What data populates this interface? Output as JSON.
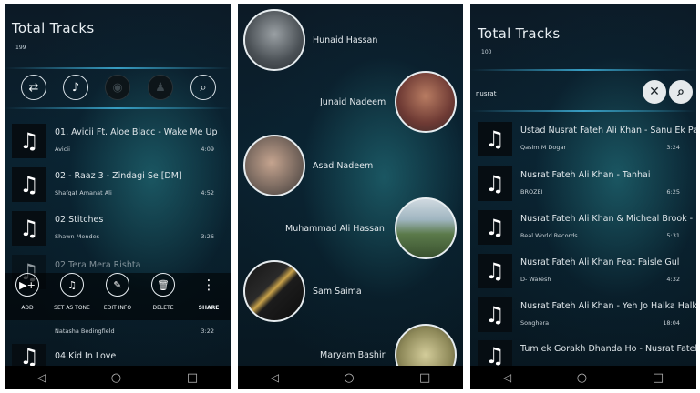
{
  "screen1": {
    "title": "Total Tracks",
    "count": "199",
    "controls": [
      {
        "icon": "shuffle-icon",
        "glyph": "⇄"
      },
      {
        "icon": "music-note-icon",
        "glyph": "♪"
      },
      {
        "icon": "disc-icon",
        "glyph": "◉"
      },
      {
        "icon": "artist-icon",
        "glyph": "♟"
      },
      {
        "icon": "search-icon",
        "glyph": "⌕"
      }
    ],
    "tracks": [
      {
        "name": "01. Avicii Ft. Aloe Blacc - Wake Me Up",
        "artist": "Avicii",
        "duration": "4:09"
      },
      {
        "name": "02 - Raaz 3 - Zindagi Se [DM]",
        "artist": "Shafqat Amanat Ali",
        "duration": "4:52"
      },
      {
        "name": "02 Stitches",
        "artist": "Shawn Mendes",
        "duration": "3:26"
      },
      {
        "name": "02 Tera Mera Rishta",
        "artist": "",
        "duration": ""
      },
      {
        "name": "",
        "artist": "Natasha Bedingfield",
        "duration": "3:22"
      },
      {
        "name": "04 Kid In Love",
        "artist": "",
        "duration": ""
      }
    ],
    "actions": [
      {
        "label": "ADD",
        "icon": "play-add-icon",
        "glyph": "▶+"
      },
      {
        "label": "SET AS TONE",
        "icon": "phone-tone-icon",
        "glyph": "♫"
      },
      {
        "label": "EDIT INFO",
        "icon": "edit-icon",
        "glyph": "✎"
      },
      {
        "label": "DELETE",
        "icon": "trash-icon",
        "glyph": "🗑"
      },
      {
        "label": "SHARE",
        "icon": "more-vert-icon",
        "glyph": "⋮"
      }
    ]
  },
  "screen2": {
    "contacts": [
      {
        "name": "Hunaid Hassan",
        "avatar_color": "#6b6f73"
      },
      {
        "name": "Junaid Nadeem",
        "avatar_color": "#8a3f3f"
      },
      {
        "name": "Asad Nadeem",
        "avatar_color": "#7b6a60"
      },
      {
        "name": "Muhammad Ali Hassan",
        "avatar_color": "#5b7a4a"
      },
      {
        "name": "Sam Saima",
        "avatar_color": "#1e1e1e"
      },
      {
        "name": "Maryam Bashir",
        "avatar_color": "#8f8a5a"
      }
    ]
  },
  "screen3": {
    "title": "Total Tracks",
    "count": "100",
    "search_value": "nusrat",
    "tracks": [
      {
        "name": "Ustad Nusrat Fateh Ali Khan - Sanu Ek Pal",
        "artist": "Qasim M Dogar",
        "duration": "3:24"
      },
      {
        "name": "Nusrat Fateh Ali Khan - Tanhai",
        "artist": "BROZEI",
        "duration": "6:25"
      },
      {
        "name": "Nusrat Fateh Ali Khan & Micheal Brook -",
        "artist": "Real World Records",
        "duration": "5:31"
      },
      {
        "name": "Nusrat Fateh Ali Khan Feat Faisle Gul",
        "artist": "D- Waresh",
        "duration": "4:32"
      },
      {
        "name": "Nusrat Fateh Ali Khan - Yeh Jo Halka Halka",
        "artist": "Songhera",
        "duration": "18:04"
      },
      {
        "name": "Tum ek Gorakh Dhanda Ho - Nusrat Fateh",
        "artist": "",
        "duration": ""
      }
    ]
  },
  "navbar": {
    "back": "◁",
    "home": "○",
    "recents": "□"
  }
}
